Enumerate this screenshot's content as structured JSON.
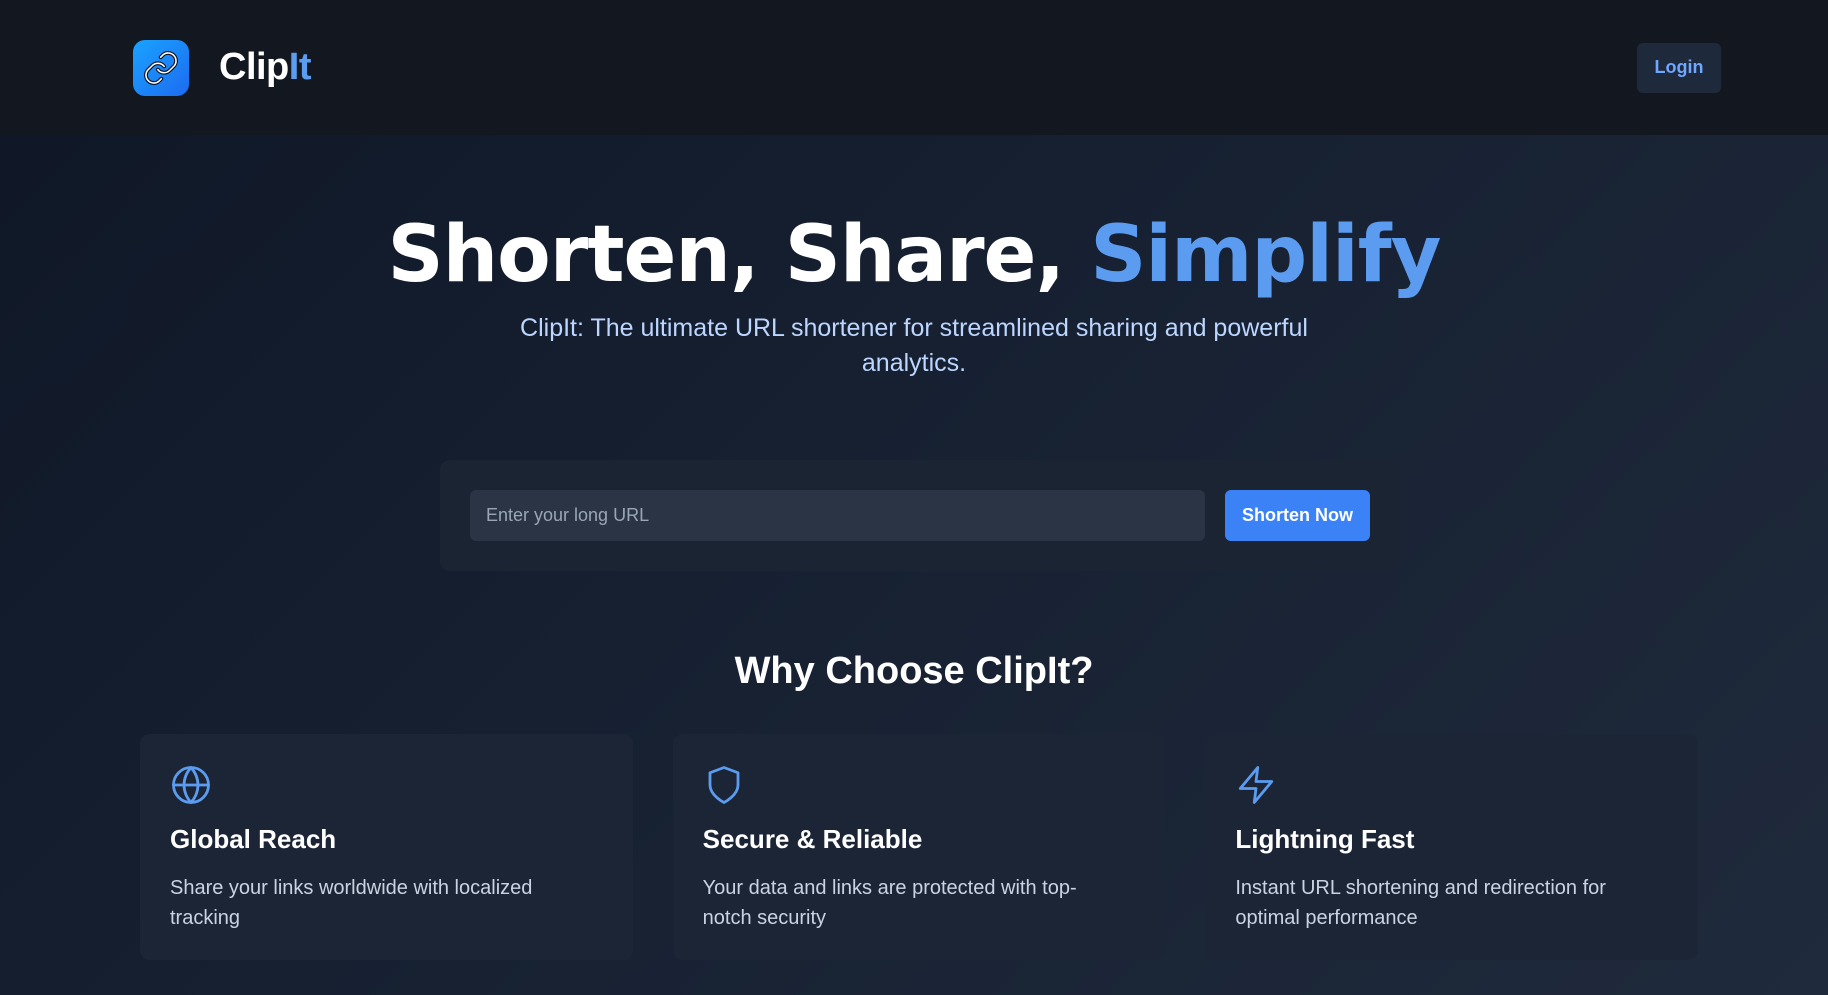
{
  "header": {
    "brand_name_part1": "Clip",
    "brand_name_part2": "It",
    "logo_icon": "link-icon",
    "login_label": "Login"
  },
  "hero": {
    "title_part1": "Shorten, Share, ",
    "title_part2": "Simplify",
    "subtitle": "ClipIt: The ultimate URL shortener for streamlined sharing and powerful analytics."
  },
  "shorten": {
    "placeholder": "Enter your long URL",
    "value": "",
    "button_label": "Shorten Now"
  },
  "why": {
    "title": "Why Choose ClipIt?",
    "features": [
      {
        "icon": "globe-icon",
        "title": "Global Reach",
        "description": "Share your links worldwide with localized tracking"
      },
      {
        "icon": "shield-icon",
        "title": "Secure & Reliable",
        "description": "Your data and links are protected with top-notch security"
      },
      {
        "icon": "lightning-icon",
        "title": "Lightning Fast",
        "description": "Instant URL shortening and redirection for optimal performance"
      }
    ]
  },
  "colors": {
    "accent": "#5b9cf0",
    "button": "#3b82f6",
    "header_bg": "#131820",
    "card_bg": "#1c2535"
  }
}
